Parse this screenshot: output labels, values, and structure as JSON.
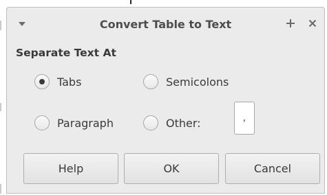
{
  "dialog": {
    "title": "Convert Table to Text",
    "section_label": "Separate Text At",
    "options": {
      "tabs": "Tabs",
      "semicolons": "Semicolons",
      "paragraph": "Paragraph",
      "other": "Other:"
    },
    "selected_option": "Tabs",
    "other_value": ",",
    "buttons": {
      "help": "Help",
      "ok": "OK",
      "cancel": "Cancel"
    }
  },
  "icons": {
    "menu": "chevron-down-icon",
    "maximize": "plus-icon",
    "close": "close-icon"
  },
  "colors": {
    "dialog_bg": "#ebebeb",
    "title_text": "#4d4d4d",
    "field_bg": "#ffffff"
  }
}
